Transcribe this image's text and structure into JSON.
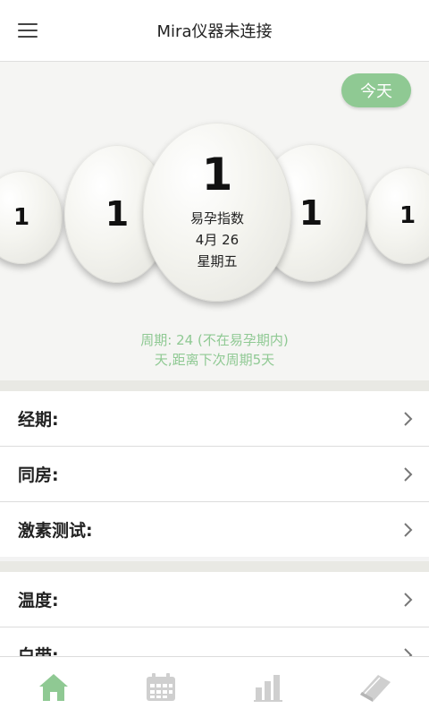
{
  "header": {
    "title": "Mira仪器未连接",
    "menu_icon": "hamburger-menu-icon"
  },
  "hero": {
    "today_label": "今天",
    "eggs": [
      {
        "number": "1"
      },
      {
        "number": "1"
      },
      {
        "number": "1",
        "label": "易孕指数",
        "date": "4月 26",
        "weekday": "星期五"
      },
      {
        "number": "1"
      },
      {
        "number": "1"
      }
    ],
    "cycle_line1": "周期: 24 (不在易孕期内)",
    "cycle_line2": "天,距离下次周期5天"
  },
  "sections": [
    {
      "rows": [
        {
          "label": "经期:"
        },
        {
          "label": "同房:"
        },
        {
          "label": "激素测试:"
        }
      ]
    },
    {
      "rows": [
        {
          "label": "温度:"
        },
        {
          "label": "白带:"
        }
      ]
    }
  ],
  "tabbar": {
    "tabs": [
      {
        "icon": "home-icon",
        "active": true
      },
      {
        "icon": "calendar-icon",
        "active": false
      },
      {
        "icon": "bar-chart-icon",
        "active": false
      },
      {
        "icon": "book-icon",
        "active": false
      }
    ]
  },
  "colors": {
    "accent": "#8fc993",
    "inactive_icon": "#cfcfcf",
    "divider": "#e9e9e4"
  }
}
